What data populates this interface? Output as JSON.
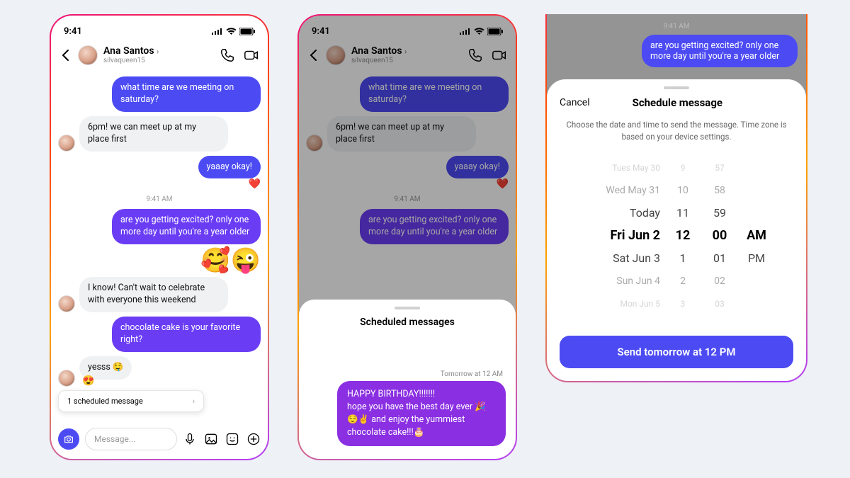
{
  "status": {
    "time": "9:41"
  },
  "chat": {
    "contact_name": "Ana Santos",
    "contact_handle": "silvaqueen15",
    "timestamp": "9:41 AM",
    "m1": "what time are we meeting on saturday?",
    "m2": "6pm! we can meet up at my place first",
    "m3": "yaaay okay!",
    "m4": "are you getting excited? only one more day until you're a year older",
    "m5": "I know! Can't wait to celebrate with everyone this weekend",
    "m6": "chocolate cake is your favorite right?",
    "m7": "yesss 🤤",
    "reaction_m3": "❤️",
    "reaction_m7": "😍",
    "sticker": "🥰😜",
    "composer_placeholder": "Message...",
    "banner_text": "1 scheduled message"
  },
  "sheet_scheduled": {
    "title": "Scheduled messages",
    "scheduled_time": "Tomorrow at 12 AM",
    "scheduled_msg": "HAPPY BIRTHDAY!!!!!!!\nhope you have the best day ever 🎉😌✌️ and enjoy the yummiest chocolate cake!!!🎂"
  },
  "sheet_schedule": {
    "bg_time": "9:41 AM",
    "bg_bubble": "are you getting excited? only one more day until you're a year older",
    "cancel": "Cancel",
    "title": "Schedule message",
    "subtitle": "Choose the date and time to send the message. Time zone is based on your device settings.",
    "rows": [
      {
        "date": "Tues May 30",
        "h": "9",
        "m": "57",
        "ap": ""
      },
      {
        "date": "Wed May 31",
        "h": "10",
        "m": "58",
        "ap": ""
      },
      {
        "date": "Today",
        "h": "11",
        "m": "59",
        "ap": ""
      },
      {
        "date": "Fri Jun 2",
        "h": "12",
        "m": "00",
        "ap": "AM"
      },
      {
        "date": "Sat Jun 3",
        "h": "1",
        "m": "01",
        "ap": "PM"
      },
      {
        "date": "Sun Jun 4",
        "h": "2",
        "m": "02",
        "ap": ""
      },
      {
        "date": "Mon Jun 5",
        "h": "3",
        "m": "03",
        "ap": ""
      }
    ],
    "send_label": "Send tomorrow at 12 PM"
  }
}
